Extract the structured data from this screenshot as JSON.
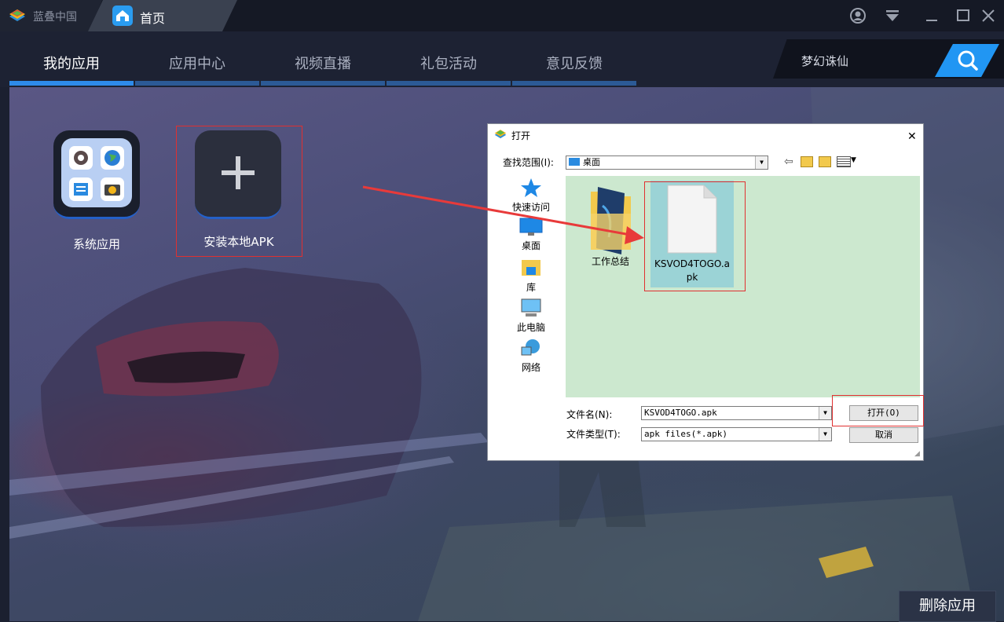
{
  "titlebar": {
    "brand": "蓝叠中国",
    "home_tab": "首页"
  },
  "nav": {
    "tabs": [
      "我的应用",
      "应用中心",
      "视频直播",
      "礼包活动",
      "意见反馈"
    ],
    "active_tab": "我的应用",
    "search_value": "梦幻诛仙"
  },
  "apps": {
    "items": [
      {
        "label": "系统应用",
        "icon": "system-apps-icon"
      },
      {
        "label": "安装本地APK",
        "icon": "plus-icon"
      }
    ]
  },
  "delete_button": "删除应用",
  "dialog": {
    "title": "打开",
    "look_in_label": "查找范围(I):",
    "look_in_value": "桌面",
    "places": [
      "快速访问",
      "桌面",
      "库",
      "此电脑",
      "网络"
    ],
    "files": [
      {
        "name": "工作总结",
        "type": "folder"
      },
      {
        "name": "KSVOD4TOGO.apk",
        "type": "file",
        "selected": true
      }
    ],
    "filename_label": "文件名(N):",
    "filename_value": "KSVOD4TOGO.apk",
    "filetype_label": "文件类型(T):",
    "filetype_value": "apk files(*.apk)",
    "open_button": "打开(O)",
    "cancel_button": "取消"
  },
  "colors": {
    "accent": "#2e8bea",
    "annotation": "#e03030",
    "file_area": "#cce8cf"
  }
}
